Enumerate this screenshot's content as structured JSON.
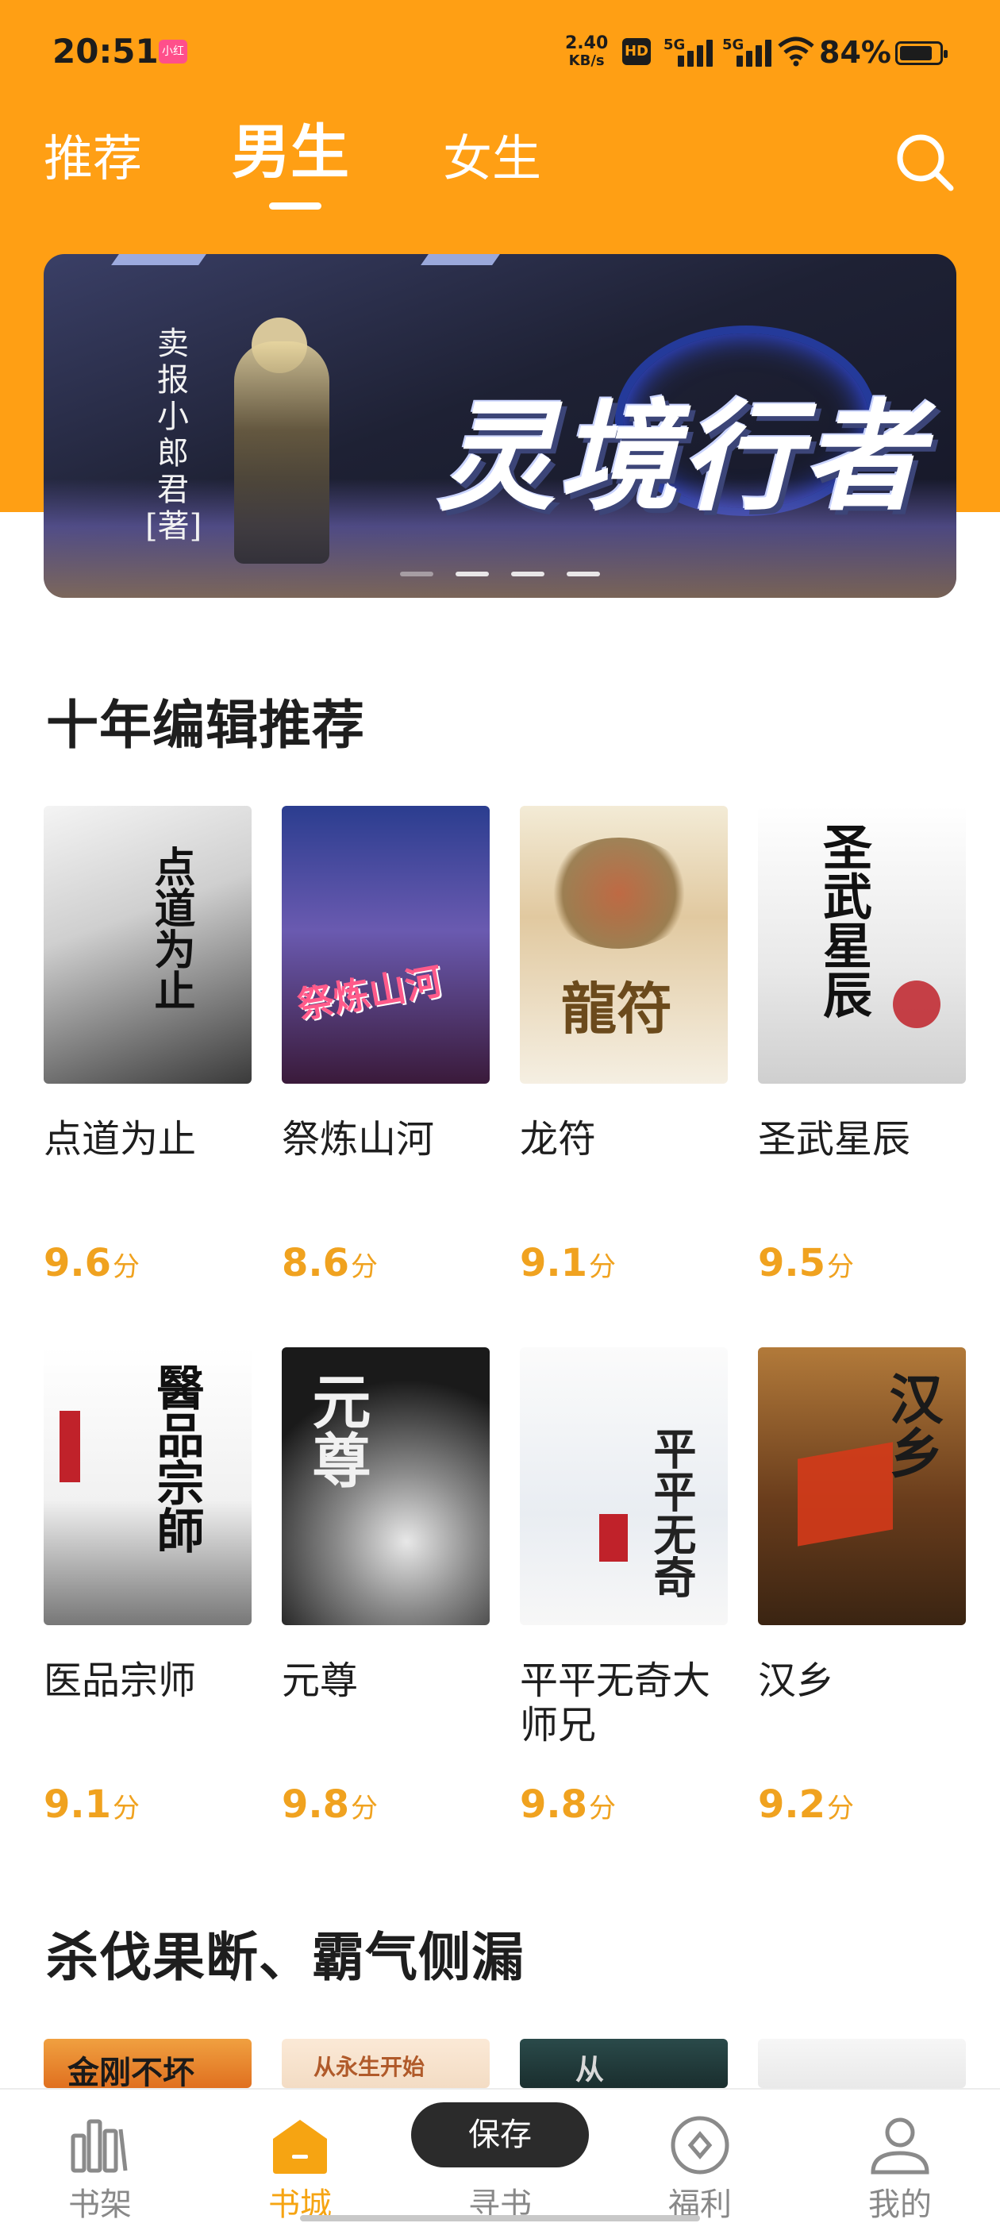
{
  "status_bar": {
    "time": "20:51",
    "app_badge": "小红",
    "net_speed_value": "2.40",
    "net_speed_unit": "KB/s",
    "hd": "HD",
    "signal1": "5G",
    "signal2": "5G",
    "battery_pct": "84%",
    "battery_level": 0.84
  },
  "top_tabs": [
    {
      "label": "推荐",
      "active": false
    },
    {
      "label": "男生",
      "active": true
    },
    {
      "label": "女生",
      "active": false
    }
  ],
  "banner": {
    "title": "灵境行者",
    "author": "卖报小郎君[著]",
    "dots": 4,
    "active_dot": 0
  },
  "sections": [
    {
      "title": "十年编辑推荐",
      "books": [
        {
          "title": "点道为止",
          "score": "9.6",
          "unit": "分"
        },
        {
          "title": "祭炼山河",
          "score": "8.6",
          "unit": "分"
        },
        {
          "title": "龙符",
          "score": "9.1",
          "unit": "分"
        },
        {
          "title": "圣武星辰",
          "score": "9.5",
          "unit": "分"
        },
        {
          "title": "医品宗师",
          "score": "9.1",
          "unit": "分"
        },
        {
          "title": "元尊",
          "score": "9.8",
          "unit": "分"
        },
        {
          "title": "平平无奇大师兄",
          "score": "9.8",
          "unit": "分"
        },
        {
          "title": "汉乡",
          "score": "9.2",
          "unit": "分"
        }
      ]
    },
    {
      "title": "杀伐果断、霸气侧漏"
    }
  ],
  "cover_texts": {
    "c1": "点道为止",
    "c2": "祭炼山河",
    "c3": "龍符",
    "c4": "圣武星辰",
    "c5": "醫品宗師",
    "c6": "元尊",
    "c7": "平平无奇",
    "c8": "汉乡",
    "c9": "金刚不坏",
    "c10": "从永生开始",
    "c11": "从"
  },
  "bottom_nav": [
    {
      "label": "书架",
      "icon": "bookshelf-icon",
      "active": false
    },
    {
      "label": "书城",
      "icon": "bookstore-icon",
      "active": true
    },
    {
      "label": "寻书",
      "icon": "find-book-icon",
      "active": false
    },
    {
      "label": "福利",
      "icon": "welfare-icon",
      "active": false
    },
    {
      "label": "我的",
      "icon": "profile-icon",
      "active": false
    }
  ],
  "save_button": "保存",
  "colors": {
    "header_orange": "#FF9F14",
    "score_orange": "#F0A21F",
    "nav_active": "#F6A412"
  }
}
